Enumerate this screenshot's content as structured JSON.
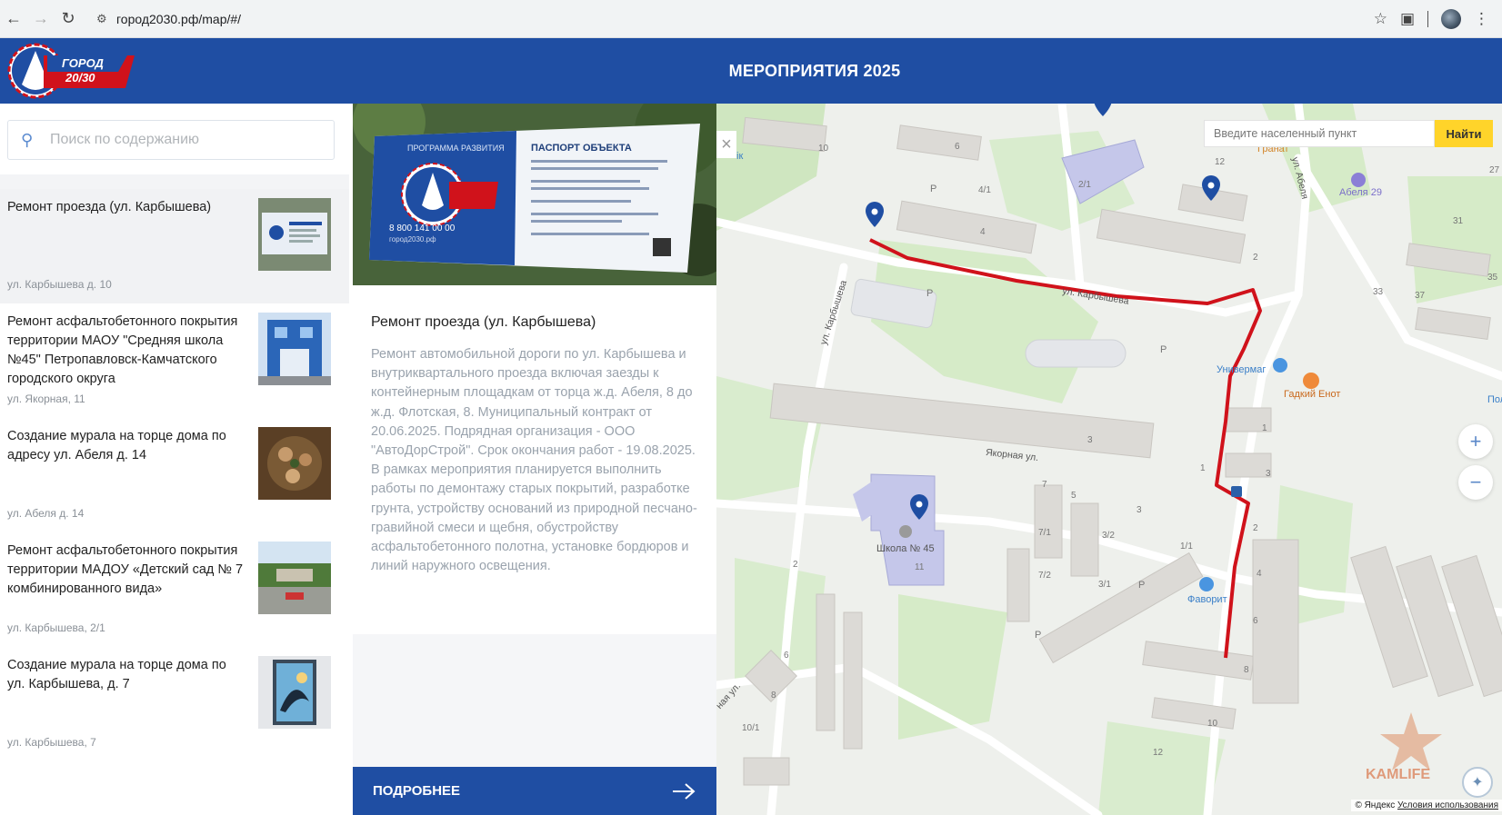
{
  "browser": {
    "url": "город2030.рф/map/#/"
  },
  "header": {
    "logo_text_line1": "ГОРОД",
    "logo_text_line2": "20/30",
    "title": "МЕРОПРИЯТИЯ 2025"
  },
  "search": {
    "placeholder": "Поиск по содержанию"
  },
  "events": [
    {
      "title": "Ремонт проезда (ул. Карбышева)",
      "address": "ул. Карбышева д. 10",
      "active": true
    },
    {
      "title": "Ремонт асфальтобетонного покрытия территории МАОУ \"Средняя школа №45\" Петропавловск-Камчатского городского округа",
      "address": "ул. Якорная, 11"
    },
    {
      "title": "Создание мурала на торце дома по адресу ул. Абеля д. 14",
      "address": "ул. Абеля д. 14"
    },
    {
      "title": "Ремонт асфальтобетонного покрытия территории МАДОУ «Детский сад № 7 комбинированного вида»",
      "address": "ул. Карбышева, 2/1"
    },
    {
      "title": "Создание мурала на торце дома по ул. Карбышева, д. 7",
      "address": "ул. Карбышева, 7"
    }
  ],
  "detail": {
    "photo_sign": {
      "program": "ПРОГРАММА РАЗВИТИЯ",
      "passport": "ПАСПОРТ ОБЪЕКТА",
      "phone": "8 800 141 00 00",
      "site": "город2030.рф"
    },
    "title": "Ремонт проезда (ул. Карбышева)",
    "description": "Ремонт автомобильной дороги по ул. Карбышева и внутриквартального проезда включая заезды к контейнерным площадкам от торца ж.д. Абеля, 8 до ж.д. Флотская, 8. Муниципальный контракт от 20.06.2025. Подрядная организация - ООО \"АвтоДорСтрой\". Срок окончания работ - 19.08.2025. В рамках мероприятия планируется выполнить работы по демонтажу старых покрытий, разработке грунта, устройству оснований из природной песчано-гравийной смеси и щебня, обустройству асфальтобетонного полотна, установке бордюров и линий наружного освещения.",
    "more_label": "ПОДРОБНЕЕ"
  },
  "map": {
    "search_placeholder": "Введите населенный пункт",
    "search_button": "Найти",
    "zoom_in": "+",
    "zoom_out": "−",
    "close": "×",
    "labels": {
      "street_karbysheva_1": "ул. Карбышева",
      "street_karbysheva_2": "ул. Карбышева",
      "street_yakornaya": "Якорная ул.",
      "street_abelya": "ул. Абеля",
      "street_bottom": "ная ул.",
      "poi_granat": "Гранат",
      "poi_abelya29": "Абеля 29",
      "poi_univermag": "Универмаг",
      "poi_gadkiy_enot": "Гадкий Енот",
      "poi_school": "Школа № 45",
      "poi_favorit": "Фаворит",
      "poi_left_edge": "ік",
      "poi_right_edge": "Пол"
    },
    "watermark": "KAMLIFE",
    "copyright_prefix": "© Яндекс",
    "copyright_link": "Условия использования",
    "route_color": "#d0121b",
    "marker_color": "#1f4ea3"
  }
}
